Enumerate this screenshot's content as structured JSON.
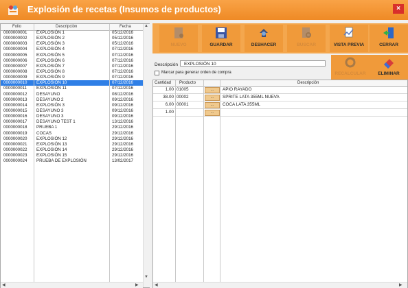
{
  "window": {
    "title": "Explosión de recetas (Insumos de productos)",
    "close_label": "×"
  },
  "left_table": {
    "headers": [
      "Folio",
      "Descripción",
      "Fecha"
    ],
    "rows": [
      [
        "0000000001",
        "EXPLOSIÓN 1",
        "05/12/2016"
      ],
      [
        "0000000002",
        "EXPLOSIÓN 2",
        "05/12/2016"
      ],
      [
        "0000000003",
        "EXPLOSIÓN 3",
        "05/12/2016"
      ],
      [
        "0000000004",
        "EXPLOSIÓN 4",
        "07/12/2016"
      ],
      [
        "0000000005",
        "EXPLOSIÓN 5",
        "07/12/2016"
      ],
      [
        "0000000006",
        "EXPLOSIÓN 6",
        "07/12/2016"
      ],
      [
        "0000000007",
        "EXPLOSIÓN 7",
        "07/12/2016"
      ],
      [
        "0000000008",
        "EXPLOSIÓN 8",
        "07/12/2016"
      ],
      [
        "0000000009",
        "EXPLOSIÓN 9",
        "07/12/2016"
      ],
      [
        "0000000010",
        "EXPLOSIÓN 10",
        "07/12/2016"
      ],
      [
        "0000000011",
        "EXPLOSIÓN 11",
        "07/12/2016"
      ],
      [
        "0000000012",
        "DESAYUNO",
        "08/12/2016"
      ],
      [
        "0000000013",
        "DESAYUNO 2",
        "09/12/2016"
      ],
      [
        "0000000014",
        "EXPLOSIÓN 3",
        "09/12/2016"
      ],
      [
        "0000000015",
        "DESAYUNO 3",
        "09/12/2016"
      ],
      [
        "0000000016",
        "DESAYUNO 3",
        "09/12/2016"
      ],
      [
        "0000000017",
        "DESAYUNO TEST 1",
        "13/12/2016"
      ],
      [
        "0000000018",
        "PRUEBA 1",
        "29/12/2016"
      ],
      [
        "0000000019",
        "COCAS",
        "29/12/2016"
      ],
      [
        "0000000020",
        "EXPLOSIÓN 12",
        "29/12/2016"
      ],
      [
        "0000000021",
        "EXPLOSIÓN 13",
        "29/12/2016"
      ],
      [
        "0000000022",
        "EXPLOSIÓN 14",
        "29/12/2016"
      ],
      [
        "0000000023",
        "EXPLOSIÓN 15",
        "29/12/2016"
      ],
      [
        "0000000024",
        "PRUEBA DE EXPLOSIÓN",
        "13/02/2017"
      ]
    ],
    "selected_index": 9
  },
  "toolbar": {
    "buttons": [
      {
        "label": "NUEVO",
        "icon": "new-document-icon",
        "enabled": false
      },
      {
        "label": "GUARDAR",
        "icon": "floppy-disk-icon",
        "enabled": true
      },
      {
        "label": "DESHACER",
        "icon": "undo-icon",
        "enabled": true
      },
      {
        "label": "BUSCAR",
        "icon": "search-document-icon",
        "enabled": false
      },
      {
        "label": "VISTA PREVIA",
        "icon": "print-preview-icon",
        "enabled": true
      },
      {
        "label": "CERRAR",
        "icon": "exit-door-icon",
        "enabled": true
      }
    ],
    "buttons2": [
      {
        "label": "RECALCULAR",
        "icon": "recycle-icon",
        "enabled": false
      },
      {
        "label": "ELIMINAR",
        "icon": "eraser-icon",
        "enabled": true
      }
    ]
  },
  "form": {
    "description_label": "Descripción",
    "description_value": "EXPLOSIÓN 10",
    "checkbox_label": "Marcar para generar orden de compra",
    "checkbox_checked": false
  },
  "detail_table": {
    "headers": [
      "Cantidad",
      "Producto",
      "Descripción"
    ],
    "rows": [
      {
        "cantidad": "1.00",
        "producto": "01005",
        "descripcion": "APIO RAYADO"
      },
      {
        "cantidad": "38.00",
        "producto": "00002",
        "descripcion": "SPRITE LATA 355ML NUEVA"
      },
      {
        "cantidad": "6.00",
        "producto": "00001",
        "descripcion": "COCA LATA 355ML"
      },
      {
        "cantidad": "1.00",
        "producto": "",
        "descripcion": ""
      }
    ],
    "lookup_button_label": "..."
  },
  "colors": {
    "title_bar": "#ef8a25",
    "toolbar": "#f4a74e",
    "selection": "#2f7fe6",
    "close": "#d8302b"
  }
}
